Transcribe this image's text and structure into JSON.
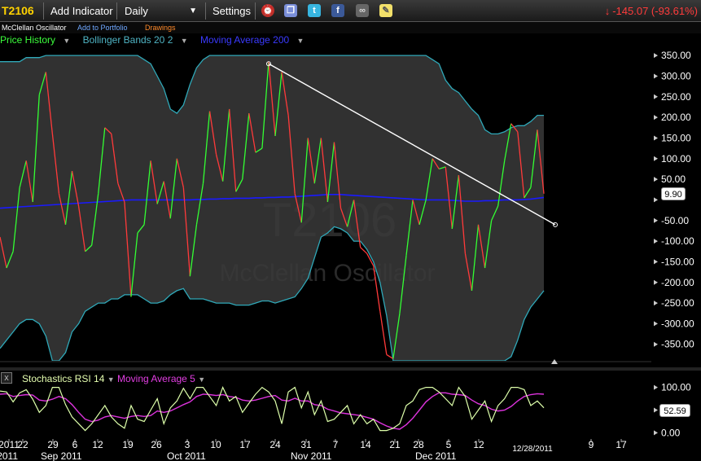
{
  "toolbar": {
    "symbol": "T2106",
    "add_indicator": "Add Indicator",
    "period": "Daily",
    "settings": "Settings",
    "change": "-145.07 (-93.61%)",
    "icons": [
      "alarm-clock-icon",
      "copy-icon",
      "twitter-icon",
      "facebook-icon",
      "binoculars-icon",
      "sticky-note-icon"
    ]
  },
  "subbar": {
    "study_name": "McClellan Oscillator",
    "add_to_portfolio": "Add to Portfolio",
    "drawings": "Drawings"
  },
  "legend": {
    "price_history": "Price History",
    "bollinger": "Bollinger Bands 20 2",
    "moving_average": "Moving Average 200"
  },
  "lower_legend": {
    "close": "x",
    "stoch_rsi": "Stochastics RSI 14",
    "moving_average": "Moving Average 5"
  },
  "watermark": {
    "symbol": "T2106",
    "name": "McClellan Oscillator"
  },
  "price_value": "9.90",
  "rsi_value": "52.59",
  "colors": {
    "up": "#33ff33",
    "down": "#ff3a3a",
    "band_line": "#2fa8b8",
    "band_fill": "#3a3a3a",
    "ma200": "#1a1aff",
    "trendline": "#ffffff",
    "stoch": "#ddffaa",
    "stoch_ma": "#dd33dd",
    "axis_text": "#ffffff",
    "negative": "#ff3b3b"
  },
  "chart_data": [
    {
      "type": "line",
      "title": "T2106 McClellan Oscillator",
      "ylim": [
        -390,
        370
      ],
      "yticks": [
        350,
        300,
        250,
        200,
        150,
        100,
        50,
        0,
        -50,
        -100,
        -150,
        -200,
        -250,
        -300,
        -350
      ],
      "ytick_labels": [
        "350.00",
        "300.00",
        "250.00",
        "200.00",
        "150.00",
        "100.00",
        "50.00",
        "",
        "-50.00",
        "-100.00",
        "-150.00",
        "-200.00",
        "-250.00",
        "-300.00",
        "-350.00"
      ],
      "series": [
        {
          "name": "Price History",
          "x": [
            0,
            1,
            2,
            3,
            4,
            5,
            6,
            7,
            8,
            9,
            10,
            11,
            12,
            13,
            14,
            15,
            16,
            17,
            18,
            19,
            20,
            21,
            22,
            23,
            24,
            25,
            26,
            27,
            28,
            29,
            30,
            31,
            32,
            33,
            34,
            35,
            36,
            37,
            38,
            39,
            40,
            41,
            42,
            43,
            44,
            45,
            46,
            47,
            48,
            49,
            50,
            51,
            52,
            53,
            54,
            55,
            56,
            57,
            58,
            59,
            60,
            61,
            62,
            63,
            64,
            65,
            66,
            67,
            68,
            69,
            70,
            71,
            72,
            73,
            74,
            75,
            76,
            77,
            78,
            79,
            80,
            81,
            82,
            83
          ],
          "values": [
            -90,
            -165,
            -125,
            30,
            95,
            -5,
            255,
            310,
            160,
            15,
            -60,
            70,
            -15,
            -125,
            -110,
            15,
            175,
            160,
            40,
            -5,
            -235,
            -80,
            -60,
            95,
            -10,
            45,
            -45,
            100,
            30,
            -185,
            -60,
            40,
            215,
            110,
            45,
            220,
            20,
            50,
            210,
            115,
            125,
            335,
            155,
            310,
            205,
            15,
            -55,
            150,
            40,
            150,
            -5,
            140,
            -20,
            -65,
            0,
            -115,
            -130,
            -160,
            -270,
            -375,
            -385,
            -275,
            -135,
            0,
            -60,
            0,
            100,
            75,
            80,
            -70,
            60,
            -130,
            -220,
            -60,
            -165,
            -50,
            -15,
            95,
            185,
            165,
            5,
            30,
            170,
            15
          ],
          "color_rule": "green rising segments, red falling segments"
        },
        {
          "name": "Bollinger Bands 20 2",
          "upper": [
            335,
            335,
            335,
            335,
            345,
            345,
            345,
            350,
            350,
            350,
            350,
            350,
            350,
            350,
            350,
            350,
            350,
            350,
            350,
            350,
            350,
            350,
            340,
            330,
            300,
            270,
            220,
            210,
            230,
            280,
            320,
            340,
            350,
            350,
            350,
            350,
            350,
            350,
            350,
            350,
            350,
            350,
            350,
            350,
            350,
            350,
            350,
            350,
            350,
            350,
            350,
            350,
            350,
            350,
            350,
            350,
            350,
            350,
            350,
            350,
            350,
            350,
            350,
            350,
            350,
            350,
            340,
            330,
            290,
            270,
            260,
            240,
            220,
            205,
            170,
            160,
            160,
            165,
            175,
            180,
            180,
            190,
            205,
            205
          ],
          "lower": [
            -360,
            -340,
            -320,
            -300,
            -290,
            -290,
            -300,
            -330,
            -390,
            -390,
            -370,
            -320,
            -300,
            -270,
            -260,
            -250,
            -250,
            -240,
            -240,
            -230,
            -230,
            -230,
            -240,
            -250,
            -250,
            -245,
            -230,
            -220,
            -215,
            -240,
            -240,
            -240,
            -245,
            -250,
            -250,
            -250,
            -255,
            -255,
            -255,
            -250,
            -245,
            -245,
            -250,
            -245,
            -240,
            -235,
            -215,
            -190,
            -140,
            -90,
            -80,
            -65,
            -70,
            -80,
            -100,
            -100,
            -120,
            -150,
            -200,
            -280,
            -390,
            -390,
            -390,
            -390,
            -390,
            -390,
            -390,
            -390,
            -390,
            -390,
            -390,
            -390,
            -390,
            -390,
            -390,
            -390,
            -390,
            -390,
            -380,
            -340,
            -290,
            -260,
            -240,
            -220
          ]
        },
        {
          "name": "Moving Average 200",
          "values": [
            -20,
            -19,
            -18,
            -17,
            -16,
            -15,
            -14,
            -13,
            -12,
            -11,
            -10,
            -9,
            -8,
            -7,
            -6,
            -5,
            -4,
            -3,
            -2,
            -1,
            0,
            0,
            0,
            0,
            0,
            0,
            0,
            0,
            0,
            0,
            1,
            1,
            2,
            2,
            3,
            3,
            4,
            4,
            4,
            5,
            5,
            6,
            6,
            7,
            7,
            8,
            9,
            10,
            11,
            12,
            13,
            13,
            13,
            12,
            11,
            10,
            9,
            8,
            7,
            6,
            5,
            4,
            3,
            2,
            1,
            0,
            0,
            0,
            0,
            -1,
            -2,
            -3,
            -3,
            -3,
            -2,
            -2,
            -1,
            0,
            0,
            0,
            1,
            2,
            4,
            6
          ]
        },
        {
          "name": "Trendline",
          "points": [
            [
              41,
              330
            ],
            [
              83,
              -60
            ]
          ]
        }
      ]
    },
    {
      "type": "line",
      "title": "Stochastics RSI 14",
      "ylim": [
        -10,
        110
      ],
      "yticks": [
        100,
        50,
        0
      ],
      "ytick_labels": [
        "100.00",
        "",
        "0.00"
      ],
      "series": [
        {
          "name": "Stochastics RSI 14",
          "values": [
            92,
            90,
            68,
            88,
            95,
            74,
            45,
            60,
            100,
            100,
            62,
            35,
            20,
            5,
            20,
            40,
            60,
            35,
            20,
            10,
            60,
            30,
            25,
            50,
            75,
            20,
            55,
            70,
            98,
            75,
            100,
            100,
            80,
            60,
            100,
            70,
            80,
            45,
            65,
            85,
            100,
            90,
            70,
            20,
            90,
            100,
            55,
            90,
            40,
            70,
            25,
            30,
            45,
            60,
            20,
            40,
            20,
            30,
            5,
            5,
            10,
            20,
            60,
            70,
            95,
            100,
            100,
            90,
            75,
            60,
            100,
            80,
            30,
            50,
            70,
            25,
            60,
            75,
            100,
            100,
            95,
            60,
            70,
            55
          ],
          "color": "#ddffaa"
        },
        {
          "name": "Moving Average 5",
          "values": [
            85,
            86,
            80,
            82,
            84,
            83,
            72,
            70,
            74,
            80,
            75,
            62,
            45,
            30,
            25,
            28,
            35,
            38,
            35,
            32,
            36,
            38,
            36,
            38,
            48,
            45,
            48,
            55,
            62,
            68,
            80,
            85,
            84,
            82,
            84,
            80,
            78,
            72,
            70,
            72,
            76,
            80,
            82,
            72,
            70,
            76,
            70,
            70,
            62,
            60,
            52,
            48,
            44,
            42,
            40,
            38,
            34,
            30,
            22,
            15,
            10,
            8,
            18,
            32,
            50,
            68,
            80,
            88,
            88,
            85,
            84,
            82,
            72,
            64,
            60,
            52,
            48,
            50,
            58,
            70,
            80,
            84,
            86,
            85
          ],
          "color": "#dd33dd"
        }
      ]
    }
  ],
  "x_axis": {
    "date_labels": [
      "2011",
      "22",
      "29",
      "6",
      "12",
      "19",
      "26",
      "3",
      "10",
      "17",
      "24",
      "31",
      "7",
      "14",
      "21",
      "28",
      "5",
      "12",
      "9",
      "17"
    ],
    "month_labels": [
      "2011",
      "Sep 2011",
      "Oct 2011",
      "Nov 2011",
      "Dec 2011"
    ],
    "current_date": "12/28/2011"
  }
}
